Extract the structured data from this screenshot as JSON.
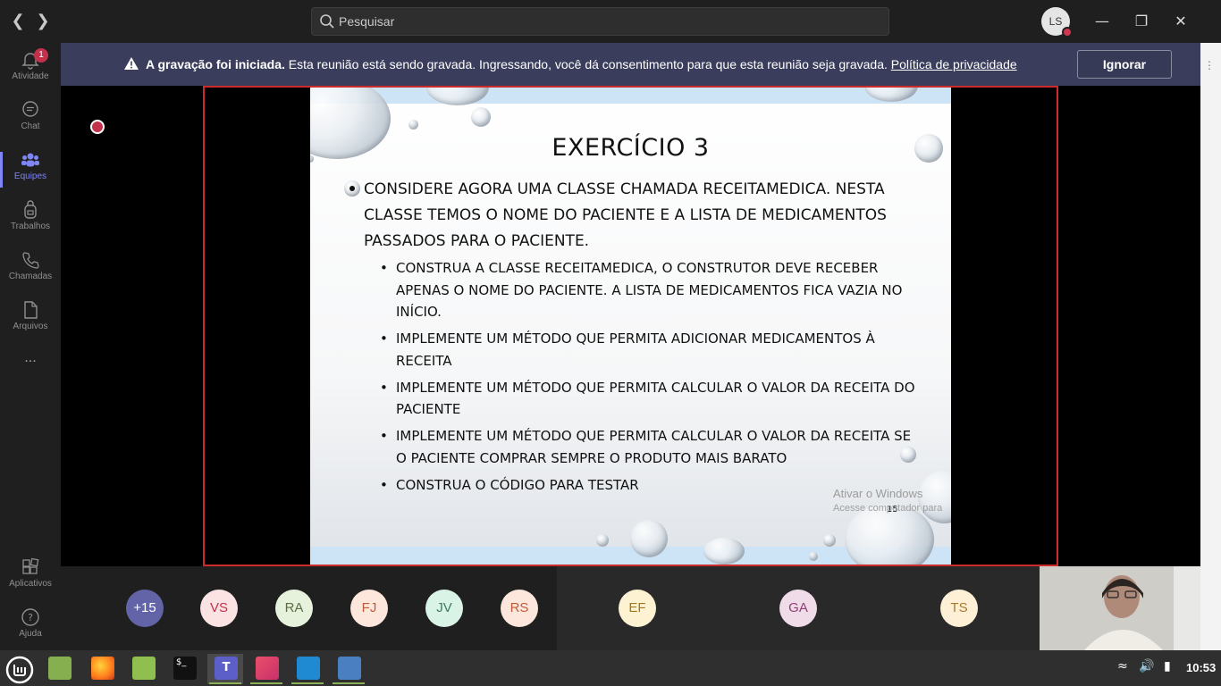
{
  "topbar": {
    "search_placeholder": "Pesquisar",
    "user_initials": "LS"
  },
  "rail": {
    "items": [
      {
        "label": "Atividade",
        "icon": "bell-icon",
        "badge": "1"
      },
      {
        "label": "Chat",
        "icon": "chat-icon"
      },
      {
        "label": "Equipes",
        "icon": "teams-icon",
        "active": true
      },
      {
        "label": "Trabalhos",
        "icon": "backpack-icon"
      },
      {
        "label": "Chamadas",
        "icon": "phone-icon"
      },
      {
        "label": "Arquivos",
        "icon": "file-icon"
      },
      {
        "label": "...",
        "icon": "more-icon"
      }
    ],
    "bottom": [
      {
        "label": "Aplicativos",
        "icon": "apps-icon"
      },
      {
        "label": "Ajuda",
        "icon": "help-icon"
      }
    ]
  },
  "banner": {
    "title": "A gravação foi iniciada.",
    "message": "Esta reunião está sendo gravada. Ingressando, você dá consentimento para que esta reunião seja gravada.",
    "link": "Política de privacidade",
    "button": "Ignorar"
  },
  "slide": {
    "title": "EXERCÍCIO 3",
    "main_bullet": "Considere agora uma classe chamada ReceitaMedica. Nesta classe temos o nome do paciente e a lista de medicamentos passados para o paciente.",
    "sub_bullets": [
      "Construa a classe ReceitaMedica, o construtor deve receber apenas o nome do paciente. A lista de medicamentos fica vazia no início.",
      "Implemente um método que permita adicionar medicamentos à receita",
      "Implemente um método que permita calcular o valor da receita do paciente",
      "Implemente um método que permita calcular o valor da receita se o paciente comprar sempre o produto mais barato",
      "Construa o código para testar"
    ],
    "page_number": "15",
    "watermark_title": "Ativar o Windows",
    "watermark_text": "Acesse                            computador para"
  },
  "participants": [
    {
      "initials": "+15",
      "bg": "#6264a7",
      "fg": "#ffffff"
    },
    {
      "initials": "VS",
      "bg": "#fbe3e3",
      "fg": "#c4314b"
    },
    {
      "initials": "RA",
      "bg": "#e7f2dc",
      "fg": "#5b6d45"
    },
    {
      "initials": "FJ",
      "bg": "#fde6dc",
      "fg": "#c25b38"
    },
    {
      "initials": "JV",
      "bg": "#d9f3e6",
      "fg": "#3e7c5b"
    },
    {
      "initials": "RS",
      "bg": "#fde6dc",
      "fg": "#c25b38"
    },
    {
      "initials": "EF",
      "bg": "#fdf2d2",
      "fg": "#a2771d"
    },
    {
      "initials": "GA",
      "bg": "#f0dbe9",
      "fg": "#8f3f73"
    },
    {
      "initials": "TS",
      "bg": "#fdf0d6",
      "fg": "#a87a2a"
    }
  ],
  "taskbar": {
    "clock": "10:53",
    "apps": [
      "mint-menu-icon",
      "folder-icon",
      "firefox-icon",
      "files-icon",
      "terminal-icon",
      "teams-app-icon",
      "image-viewer-icon",
      "vscode-icon",
      "screenshot-icon"
    ]
  }
}
